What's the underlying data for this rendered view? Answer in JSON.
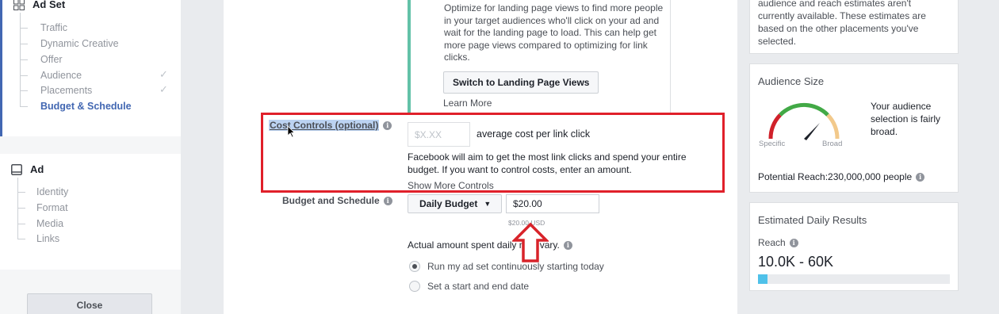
{
  "sidebar": {
    "adset_title": "Ad Set",
    "adset_items": [
      {
        "label": "Traffic",
        "checked": false
      },
      {
        "label": "Dynamic Creative",
        "checked": false
      },
      {
        "label": "Offer",
        "checked": false
      },
      {
        "label": "Audience",
        "checked": true
      },
      {
        "label": "Placements",
        "checked": true
      },
      {
        "label": "Budget & Schedule",
        "checked": false,
        "active": true
      }
    ],
    "ad_title": "Ad",
    "ad_items": [
      {
        "label": "Identity"
      },
      {
        "label": "Format"
      },
      {
        "label": "Media"
      },
      {
        "label": "Links"
      }
    ],
    "close_label": "Close"
  },
  "main": {
    "info_text": "Optimize for landing page views to find more people in your target audiences who'll click on your ad and wait for the landing page to load. This can help get more page views compared to optimizing for link clicks.",
    "switch_button": "Switch to Landing Page Views",
    "learn_more": "Learn More",
    "cost_controls_label": "Cost Controls (optional)",
    "cost_input_placeholder": "$X.XX",
    "cost_suffix": "average cost per link click",
    "cost_help": "Facebook will aim to get the most link clicks and spend your entire budget. If you want to control costs, enter an amount.",
    "show_more": "Show More Controls",
    "budget_label": "Budget and Schedule",
    "budget_type": "Daily Budget",
    "budget_value": "$20.00",
    "budget_note": "$20.00 USD",
    "actual_text": "Actual amount spent daily may vary.",
    "radio_continuous": "Run my ad set continuously starting today",
    "radio_dates": "Set a start and end date",
    "radio_selected": "continuous"
  },
  "right": {
    "top_text": "audience and reach estimates aren't currently available. These estimates are based on the other placements you've selected.",
    "audience_title": "Audience Size",
    "gauge_specific": "Specific",
    "gauge_broad": "Broad",
    "audience_desc": "Your audience selection is fairly broad.",
    "potential_reach": "Potential Reach:230,000,000 people",
    "estimated_title": "Estimated Daily Results",
    "reach_label": "Reach",
    "reach_value": "10.0K - 60K",
    "reach_fill_fraction": 0.05
  },
  "colors": {
    "highlight_box": "#e0202a",
    "arrow": "#d8232a",
    "accent": "#4267b2",
    "info_border": "#63c2a8",
    "reach_bar": "#4fc1e9"
  }
}
